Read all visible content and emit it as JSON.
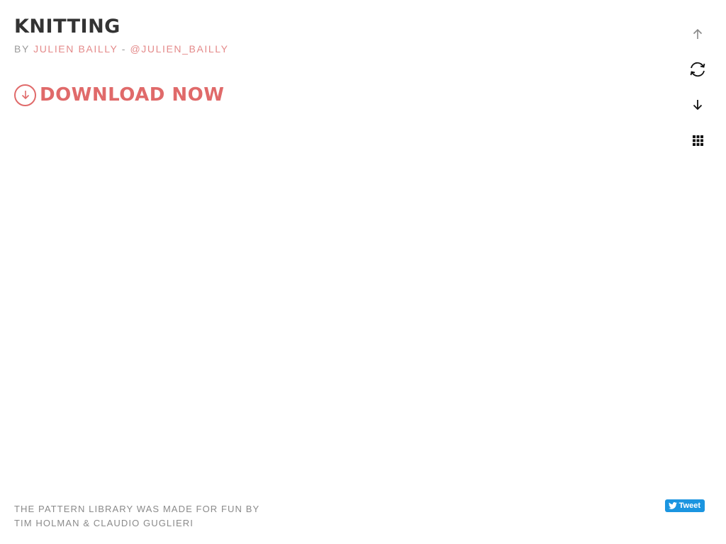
{
  "header": {
    "title": "KNITTING",
    "by_prefix": "BY",
    "author_name": "JULIEN BAILLY",
    "separator": "-",
    "author_handle": "@JULIEN_BAILLY"
  },
  "download": {
    "label": "DOWNLOAD NOW",
    "icon": "arrow-down-circle-icon"
  },
  "side_nav": [
    {
      "name": "previous-pattern",
      "icon": "arrow-up-icon"
    },
    {
      "name": "random-pattern",
      "icon": "refresh-icon"
    },
    {
      "name": "next-pattern",
      "icon": "arrow-down-icon"
    },
    {
      "name": "grid-view",
      "icon": "grid-icon"
    }
  ],
  "footer": {
    "line1": "THE PATTERN LIBRARY WAS MADE FOR FUN BY",
    "line2": "TIM HOLMAN & CLAUDIO GUGLIERI"
  },
  "tweet": {
    "label": "Tweet",
    "icon": "twitter-bird-icon"
  },
  "colors": {
    "accent": "#e06a6a",
    "link": "#e48a8a",
    "title": "#333333",
    "muted": "#9a9a9a",
    "tweet_bg": "#1b95e0"
  }
}
